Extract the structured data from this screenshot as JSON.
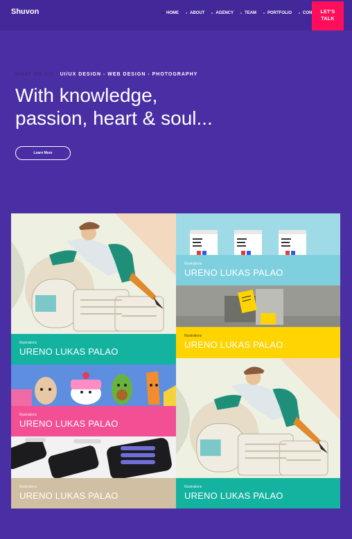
{
  "brand": "Shuvon",
  "nav": {
    "items": [
      {
        "label": "HOME",
        "active": true
      },
      {
        "label": "ABOUT",
        "active": false
      },
      {
        "label": "AGENCY",
        "active": false
      },
      {
        "label": "TEAM",
        "active": false
      },
      {
        "label": "PORTFOLIO",
        "active": false
      },
      {
        "label": "CONTACT",
        "active": false
      }
    ],
    "cta_line1": "LET'S",
    "cta_line2": "TALK"
  },
  "hero": {
    "eyebrow_muted": "WHAT WE DO",
    "eyebrow_strong": "UI/UX DESIGN - WEB DESIGN - PHOTOGRAPHY",
    "headline_line1": "With knowledge,",
    "headline_line2": "passion, heart & soul...",
    "button_label": "Learn More"
  },
  "portfolio": {
    "cards": [
      {
        "category": "Illustrations",
        "title": "URENO LUKAS PALAO",
        "caption_color": "#14b3a0",
        "art": "pen-rider-illustration"
      },
      {
        "category": "Illustrations",
        "title": "URENO LUKAS PALAO",
        "caption_color": "#7ed0de",
        "art": "business-cards-photo"
      },
      {
        "category": "Illustrations",
        "title": "URENO LUKAS PALAO",
        "caption_color": "#ffd400",
        "art": "yellow-card-stand-photo"
      },
      {
        "category": "Illustrations",
        "title": "URENO LUKAS PALAO",
        "caption_color": "#f34f95",
        "art": "food-characters-illustration"
      },
      {
        "category": "Illustrations",
        "title": "URENO LUKAS PALAO",
        "caption_color": "#14b3a0",
        "art": "pen-rider-illustration"
      },
      {
        "category": "Illustrations",
        "title": "URENO LUKAS PALAO",
        "caption_color": "#d1bfa3",
        "art": "phone-mockups-photo"
      }
    ]
  },
  "colors": {
    "background": "#4a2ea3",
    "topbar": "#43289a",
    "accent": "#ff0f5b"
  }
}
